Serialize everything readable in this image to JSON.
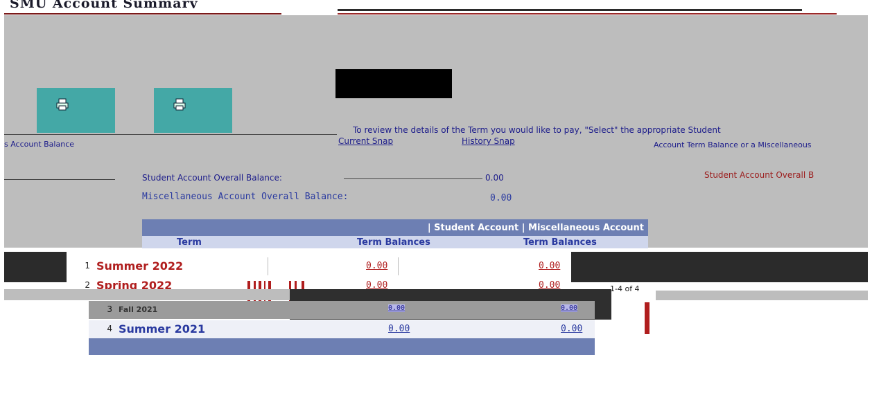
{
  "page": {
    "title": "SMU Account Summary"
  },
  "toolbar": {
    "print_icon": "printer-icon"
  },
  "instructions": {
    "main": "To review the details of the Term you would like to pay, \"Select\" the appropriate Student",
    "right": "Account Term Balance or a Miscellaneous",
    "left_label": "s Account Balance"
  },
  "tabs": {
    "current": "Current Snap",
    "history": "History Snap"
  },
  "overall": {
    "student_label": "Student Account Overall Balance:",
    "student_value": "0.00",
    "student_right_link": "Student Account Overall B",
    "misc_label": "Miscellaneous Account Overall Balance:",
    "misc_value": "0.00"
  },
  "grid": {
    "header": "| Student Account | Miscellaneous Account",
    "columns": {
      "term": "Term",
      "student_term_balances": "Term Balances",
      "misc_term_balances": "Term Balances"
    },
    "rows": [
      {
        "num": "1",
        "term": "Summer 2022",
        "student_balance": "0.00",
        "misc_balance": "0.00"
      },
      {
        "num": "2",
        "term": "Spring 2022",
        "student_balance": "0.00",
        "misc_balance": "0.00"
      },
      {
        "num": "3",
        "term": "Fall 2021",
        "student_balance": "0.00",
        "misc_balance": "0.00"
      },
      {
        "num": "4",
        "term": "Summer 2021",
        "student_balance": "0.00",
        "misc_balance": "0.00"
      }
    ],
    "page_counter": "1-4 of 4"
  },
  "colors": {
    "accent_teal": "#44a8a6",
    "grid_header": "#6d7fb3",
    "term_red": "#b01e1e",
    "link_blue": "#2a3aa0"
  }
}
